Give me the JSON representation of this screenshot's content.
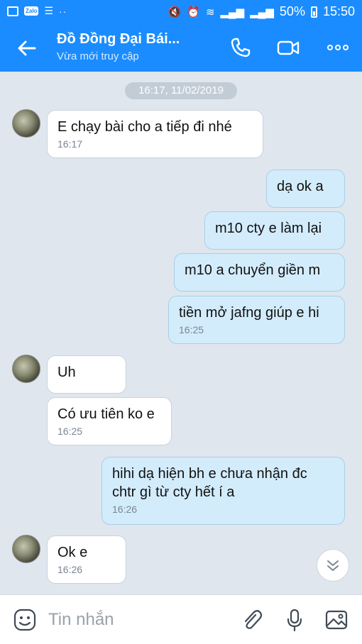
{
  "status_bar": {
    "battery": "50%",
    "time": "15:50",
    "zalo_label": "Zalo"
  },
  "header": {
    "title": "Đồ Đồng Đại Bái...",
    "subtitle": "Vừa mới truy cập"
  },
  "date_separator": "16:17, 11/02/2019",
  "messages": [
    {
      "side": "in",
      "text": "E chạy bài cho a tiếp đi nhé",
      "time": "16:17"
    },
    {
      "side": "out",
      "text": "dạ ok a",
      "time": ""
    },
    {
      "side": "out",
      "text": "m10 cty e làm lại",
      "time": ""
    },
    {
      "side": "out",
      "text": "m10 a chuyển giền m",
      "time": ""
    },
    {
      "side": "out",
      "text": "tiền mở jafng giúp e hi",
      "time": "16:25"
    },
    {
      "side": "in",
      "text": "Uh",
      "time": ""
    },
    {
      "side": "in",
      "text": "Có ưu tiên ko e",
      "time": "16:25"
    },
    {
      "side": "out",
      "text": "hihi dạ hiện bh e chưa nhận đc chtr gì từ cty hết í a",
      "time": "16:26"
    },
    {
      "side": "in",
      "text": "Ok e",
      "time": "16:26"
    }
  ],
  "composer": {
    "placeholder": "Tin nhắn"
  },
  "icons": {
    "back": "arrow-left-icon",
    "call": "phone-icon",
    "video": "video-camera-icon",
    "more": "more-dots-icon",
    "sticker": "sticker-face-icon",
    "attach": "paperclip-icon",
    "mic": "microphone-icon",
    "image": "image-icon",
    "scroll": "chevron-double-down-icon"
  },
  "colors": {
    "accent": "#1a8cff",
    "outgoing_bubble": "#d3ecfc",
    "incoming_bubble": "#ffffff",
    "background": "#dfe6ee"
  }
}
